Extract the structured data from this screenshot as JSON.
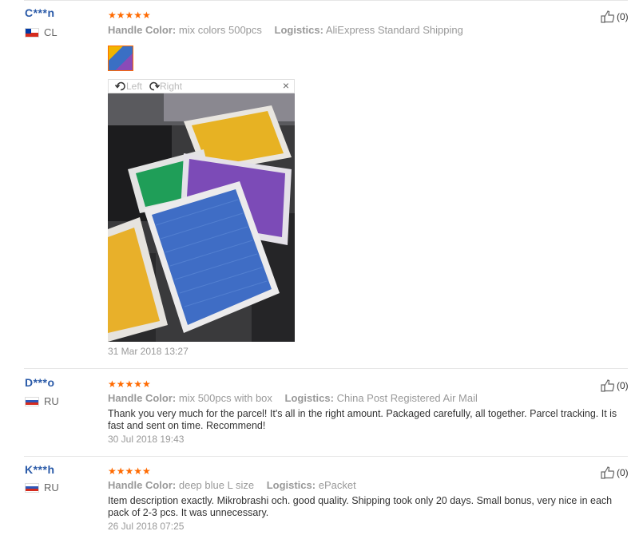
{
  "reviews": [
    {
      "user": "C***n",
      "country": "CL",
      "stars": "★★★★★",
      "attr_label_1": "Handle Color:",
      "attr_value_1": "mix colors 500pcs",
      "attr_label_2": "Logistics:",
      "attr_value_2": "AliExpress Standard Shipping",
      "helpful": "(0)",
      "text": "",
      "date": "31 Mar 2018 13:27",
      "viewer": {
        "left_label": "Left",
        "right_label": "Right",
        "close": "×"
      }
    },
    {
      "user": "D***o",
      "country": "RU",
      "stars": "★★★★★",
      "attr_label_1": "Handle Color:",
      "attr_value_1": "mix 500pcs with box",
      "attr_label_2": "Logistics:",
      "attr_value_2": "China Post Registered Air Mail",
      "helpful": "(0)",
      "text": "Thank you very much for the parcel! It's all in the right amount. Packaged carefully, all together. Parcel tracking. It is fast and sent on time. Recommend!",
      "date": "30 Jul 2018 19:43"
    },
    {
      "user": "K***h",
      "country": "RU",
      "stars": "★★★★★",
      "attr_label_1": "Handle Color:",
      "attr_value_1": "deep blue L size",
      "attr_label_2": "Logistics:",
      "attr_value_2": "ePacket",
      "helpful": "(0)",
      "text": "Item description exactly. Mikrobrashi och. good quality. Shipping took only 20 days. Small bonus, very nice in each pack of 2-3 pcs. It was unnecessary.",
      "date": "26 Jul 2018 07:25"
    }
  ],
  "colors": {
    "user": "#2a5aa8",
    "stars": "#ff6a00",
    "muted": "#999999"
  }
}
